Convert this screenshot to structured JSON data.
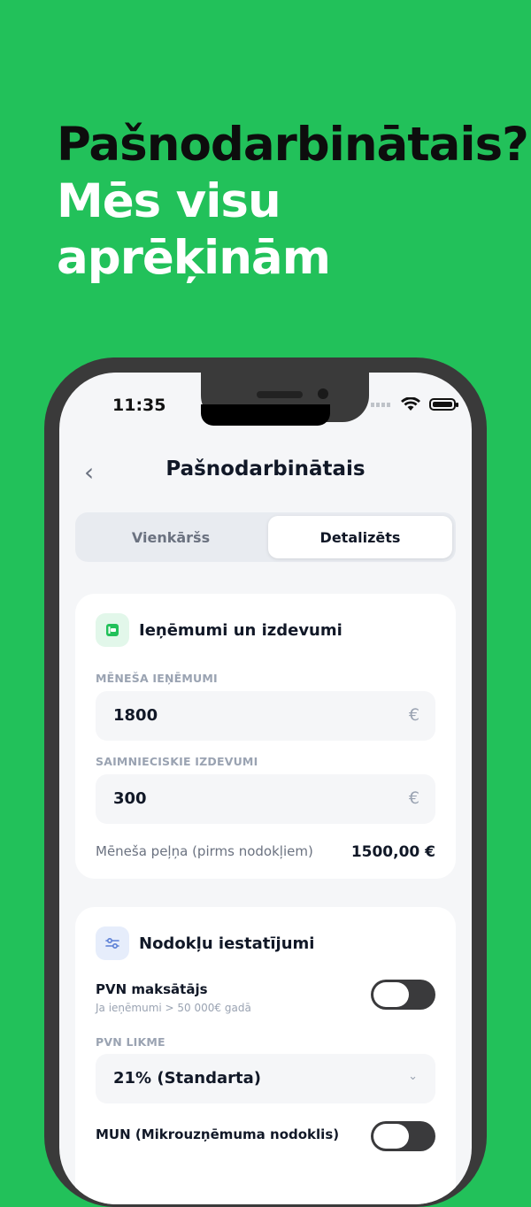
{
  "headline": {
    "line1": "Pašnodarbinātais?",
    "line2": "Mēs visu",
    "line3": "aprēķinām"
  },
  "status": {
    "time": "11:35"
  },
  "nav": {
    "title": "Pašnodarbinātais"
  },
  "segments": [
    "Vienkāršs",
    "Detalizēts"
  ],
  "selected_segment": "Detalizēts",
  "income_card": {
    "title": "Ieņēmumi un izdevumi",
    "revenue_label": "MĒNEŠA IEŅĒMUMI",
    "revenue_value": "1800",
    "expenses_label": "SAIMNIECISKIE IZDEVUMI",
    "expenses_value": "300",
    "currency": "€",
    "profit_label": "Mēneša peļņa (pirms nodokļiem)",
    "profit_value": "1500,00 €"
  },
  "tax_card": {
    "title": "Nodokļu iestatījumi",
    "vat_payer_label": "PVN maksātājs",
    "vat_payer_hint": "Ja ieņēmumi > 50 000€ gadā",
    "vat_payer_on": false,
    "vat_rate_label": "PVN LIKME",
    "vat_rate_value": "21% (Standarta)",
    "mun_label": "MUN (Mikrouzņēmuma nodoklis)",
    "mun_on": false
  },
  "colors": {
    "background": "#22c15a",
    "accent_green": "#22c15a",
    "text_dark": "#111827",
    "muted": "#9aa3b2"
  }
}
